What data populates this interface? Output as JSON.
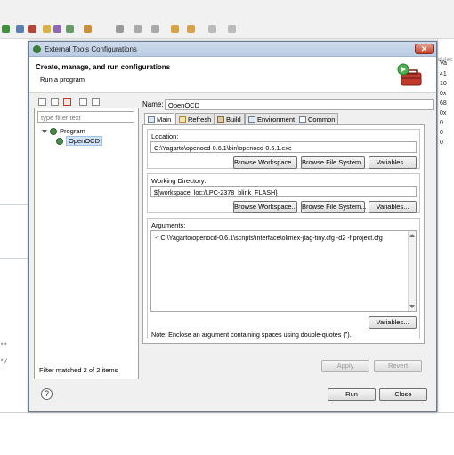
{
  "background": {
    "right_panel": {
      "header": "dules",
      "values": [
        "Va",
        "41",
        "10",
        "0x",
        "68",
        "0x",
        "0",
        "0",
        "0"
      ]
    },
    "code_fragments": [
      "**",
      "*/"
    ]
  },
  "dialog": {
    "title": "External Tools Configurations",
    "close_glyph": "✕",
    "banner_title": "Create, manage, and run configurations",
    "banner_subtitle": "Run a program",
    "filter_placeholder": "type filter text",
    "tree": {
      "category": "Program",
      "selected_item": "OpenOCD"
    },
    "filter_status": "Filter matched 2 of 2 items",
    "name_label": "Name:",
    "name_value": "OpenOCD",
    "tabs": [
      {
        "label": "Main",
        "icon": "main-tab-icon"
      },
      {
        "label": "Refresh",
        "icon": "refresh-icon"
      },
      {
        "label": "Build",
        "icon": "build-icon"
      },
      {
        "label": "Environment",
        "icon": "environment-icon"
      },
      {
        "label": "Common",
        "icon": "common-icon"
      }
    ],
    "location": {
      "label": "Location:",
      "value": "C:\\Yagarto\\openocd-0.6.1\\bin\\openocd-0.6.1.exe",
      "browse_workspace": "Browse Workspace...",
      "browse_filesystem": "Browse File System...",
      "variables": "Variables..."
    },
    "working_directory": {
      "label": "Working Directory:",
      "value": "${workspace_loc:/LPC-2378_blink_FLASH}",
      "browse_workspace": "Browse Workspace...",
      "browse_filesystem": "Browse File System...",
      "variables": "Variables..."
    },
    "arguments": {
      "label": "Arguments:",
      "value": "-f C:\\Yagarto\\openocd-0.6.1\\scripts\\interface\\olimex-jtag-tiny.cfg -d2 -f project.cfg",
      "variables": "Variables..."
    },
    "note": "Note: Enclose an argument containing spaces using double-quotes (\").",
    "apply": "Apply",
    "revert": "Revert",
    "help_glyph": "?",
    "run": "Run",
    "close": "Close"
  }
}
